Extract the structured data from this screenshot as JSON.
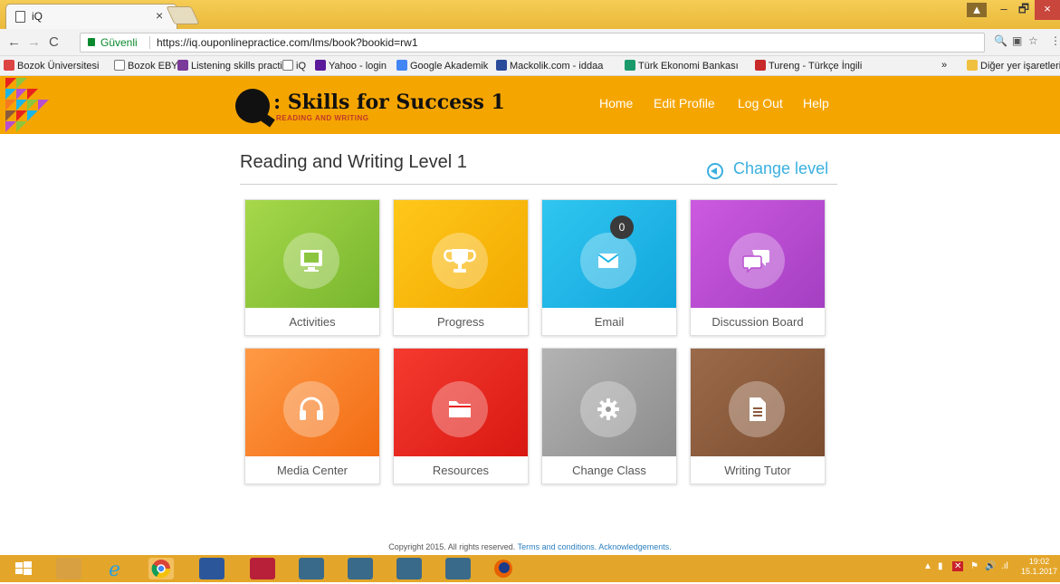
{
  "browser": {
    "tab_title": "iQ",
    "tab_close": "×",
    "secure_label": "Güvenli",
    "url": "https://iq.ouponlinepractice.com/lms/book?bookid=rw1",
    "window_controls": {
      "user": "▲",
      "min": "–",
      "max": "🗗",
      "close": "×"
    }
  },
  "bookmarks": [
    "Bozok Üniversitesi",
    "Bozok EBYS",
    "Listening skills practic",
    "iQ",
    "Yahoo - login",
    "Google Akademik",
    "Mackolik.com - iddaa",
    "Türk Ekonomi Bankası",
    "Tureng - Türkçe İngili",
    "»",
    "Diğer yer işaretleri"
  ],
  "header": {
    "logo_title": ": Skills for Success 1",
    "logo_subtitle": "READING AND WRITING",
    "nav": [
      "Home",
      "Edit Profile",
      "Log Out",
      "Help"
    ]
  },
  "main": {
    "page_title": "Reading and Writing Level 1",
    "change_level": "Change level",
    "tiles": [
      {
        "label": "Activities",
        "color": "#8cc63f",
        "icon": "monitor-icon"
      },
      {
        "label": "Progress",
        "color": "#f7b500",
        "icon": "trophy-icon"
      },
      {
        "label": "Email",
        "color": "#1bb6e8",
        "icon": "envelope-icon",
        "badge": "0"
      },
      {
        "label": "Discussion Board",
        "color": "#b84fd0",
        "icon": "chat-bubbles-icon"
      },
      {
        "label": "Media Center",
        "color": "#f57a20",
        "icon": "headphones-icon"
      },
      {
        "label": "Resources",
        "color": "#e8231f",
        "icon": "folder-icon"
      },
      {
        "label": "Change Class",
        "color": "#999999",
        "icon": "gear-icon"
      },
      {
        "label": "Writing Tutor",
        "color": "#8c5a3c",
        "icon": "document-icon"
      }
    ]
  },
  "footer": {
    "copyright": "Copyright 2015. All rights reserved.",
    "terms": "Terms and conditions.",
    "acknowledgements": "Acknowledgements."
  },
  "taskbar": {
    "time": "19:02",
    "date": "15.1.2017"
  }
}
